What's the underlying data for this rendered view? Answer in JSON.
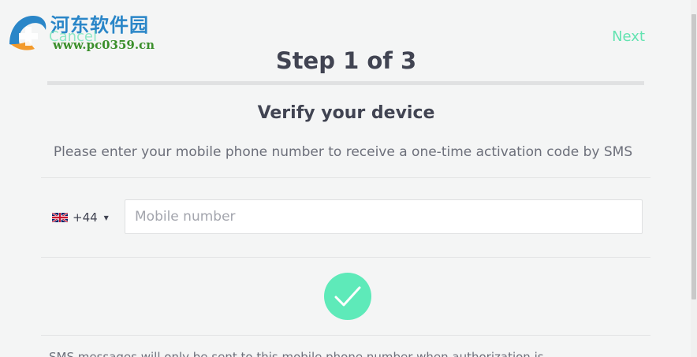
{
  "watermark": {
    "title": "河东软件园",
    "url": "www.pc0359.cn",
    "logo_icon": "watermark-logo-icon"
  },
  "header": {
    "cancel_label": "Cancel",
    "next_label": "Next",
    "step_title": "Step 1 of 3"
  },
  "verify": {
    "heading": "Verify your device",
    "description": "Please enter your mobile phone number to receive a one-time activation code by SMS"
  },
  "phone": {
    "country_flag_icon": "uk-flag-icon",
    "dial_code": "+44",
    "dropdown_icon": "caret-down-icon",
    "value": "",
    "placeholder": "Mobile number"
  },
  "submit": {
    "icon": "checkmark-icon"
  },
  "footer": {
    "note": "SMS messages will only be sent to this mobile phone number when authorization is..."
  },
  "colors": {
    "accent": "#5eeab9",
    "link": "#63e3b1",
    "heading": "#414452",
    "body_text": "#6c6f7a",
    "background": "#f4f5f5",
    "watermark_blue": "#2a86c8",
    "watermark_green": "#3b8f2b"
  }
}
